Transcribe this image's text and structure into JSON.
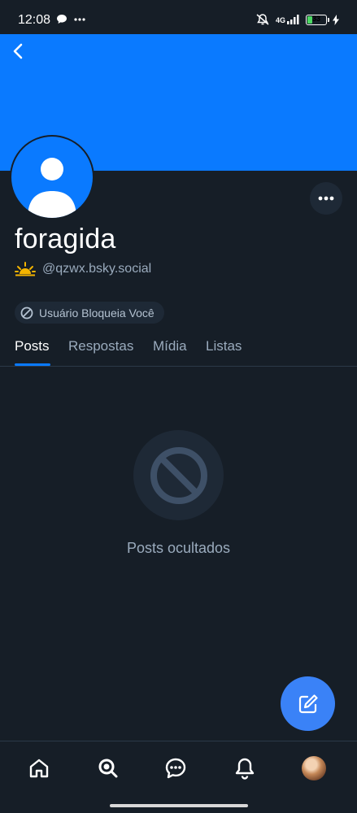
{
  "status_bar": {
    "time": "12:08",
    "network": "4G",
    "battery": "33",
    "battery_level": 0.33
  },
  "profile": {
    "display_name": "foragida",
    "handle": "@qzwx.bsky.social",
    "blocked_badge": "Usuário Bloqueia Você"
  },
  "tabs": [
    {
      "label": "Posts",
      "active": true
    },
    {
      "label": "Respostas",
      "active": false
    },
    {
      "label": "Mídia",
      "active": false
    },
    {
      "label": "Listas",
      "active": false
    }
  ],
  "empty_state": {
    "text": "Posts ocultados",
    "icon": "ban-icon"
  },
  "colors": {
    "accent": "#0a7aff",
    "background": "#161e27",
    "surface": "#1e2936",
    "muted_text": "#9aabbd",
    "compose": "#3a82f7"
  },
  "bottom_nav": [
    {
      "icon": "home-icon"
    },
    {
      "icon": "search-icon"
    },
    {
      "icon": "chat-icon"
    },
    {
      "icon": "bell-icon"
    },
    {
      "icon": "profile-avatar"
    }
  ]
}
